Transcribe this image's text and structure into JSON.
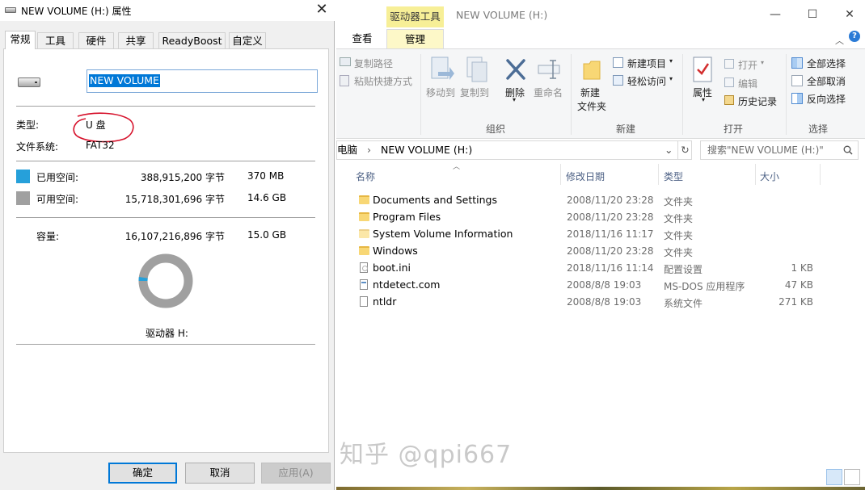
{
  "properties_dialog": {
    "title": "NEW VOLUME (H:) 属性",
    "close_glyph": "✕",
    "tabs": [
      "常规",
      "工具",
      "硬件",
      "共享",
      "ReadyBoost",
      "自定义"
    ],
    "active_tab": "常规",
    "volume_name": "NEW VOLUME",
    "type_label": "类型:",
    "type_value": "U 盘",
    "fs_label": "文件系统:",
    "fs_value": "FAT32",
    "used": {
      "label": "已用空间:",
      "bytes": "388,915,200 字节",
      "size": "370 MB",
      "color": "#26a0da"
    },
    "free": {
      "label": "可用空间:",
      "bytes": "15,718,301,696 字节",
      "size": "14.6 GB",
      "color": "#a0a0a0"
    },
    "capacity": {
      "label": "容量:",
      "bytes": "16,107,216,896 字节",
      "size": "15.0 GB"
    },
    "used_fraction": 0.0241,
    "drive_label": "驱动器 H:",
    "annotation_color": "#d6102a",
    "buttons": {
      "ok": "确定",
      "cancel": "取消",
      "apply": "应用(A)"
    }
  },
  "explorer": {
    "context_tab_group": "驱动器工具",
    "window_title": "NEW VOLUME (H:)",
    "window_controls": {
      "minimize": "—",
      "maximize": "☐",
      "close": "✕"
    },
    "ribbon_tabs": [
      "查看",
      "管理"
    ],
    "active_ribbon_tab": "管理",
    "ribbon": {
      "clipboard_items": [
        "复制路径",
        "粘贴快捷方式"
      ],
      "organize": {
        "name": "组织",
        "move_to": "移动到",
        "copy_to": "复制到",
        "delete": "删除",
        "rename": "重命名"
      },
      "new": {
        "name": "新建",
        "new_folder_line1": "新建",
        "new_folder_line2": "文件夹",
        "new_item": "新建项目",
        "easy_access": "轻松访问"
      },
      "open": {
        "name": "打开",
        "properties": "属性",
        "open": "打开",
        "edit": "编辑",
        "history": "历史记录"
      },
      "select": {
        "name": "选择",
        "select_all": "全部选择",
        "select_none": "全部取消",
        "invert": "反向选择"
      }
    },
    "address": {
      "path_prefix": "电脑",
      "separator": "›",
      "current": "NEW VOLUME (H:)",
      "chevron": "⌄",
      "refresh": "↻"
    },
    "search_placeholder": "搜索\"NEW VOLUME (H:)\"",
    "columns": {
      "name": "名称",
      "date": "修改日期",
      "type": "类型",
      "size": "大小"
    },
    "files": [
      {
        "name": "Documents and Settings",
        "date": "2008/11/20 23:28",
        "type": "文件夹",
        "size": "",
        "icon": "folder"
      },
      {
        "name": "Program Files",
        "date": "2008/11/20 23:28",
        "type": "文件夹",
        "size": "",
        "icon": "folder"
      },
      {
        "name": "System Volume Information",
        "date": "2018/11/16 11:17",
        "type": "文件夹",
        "size": "",
        "icon": "folder-light"
      },
      {
        "name": "Windows",
        "date": "2008/11/20 23:28",
        "type": "文件夹",
        "size": "",
        "icon": "folder"
      },
      {
        "name": "boot.ini",
        "date": "2018/11/16 11:14",
        "type": "配置设置",
        "size": "1 KB",
        "icon": "ini"
      },
      {
        "name": "ntdetect.com",
        "date": "2008/8/8 19:03",
        "type": "MS-DOS 应用程序",
        "size": "47 KB",
        "icon": "exe"
      },
      {
        "name": "ntldr",
        "date": "2008/8/8 19:03",
        "type": "系统文件",
        "size": "271 KB",
        "icon": "file"
      }
    ]
  },
  "watermark": "知乎 @qpi667"
}
